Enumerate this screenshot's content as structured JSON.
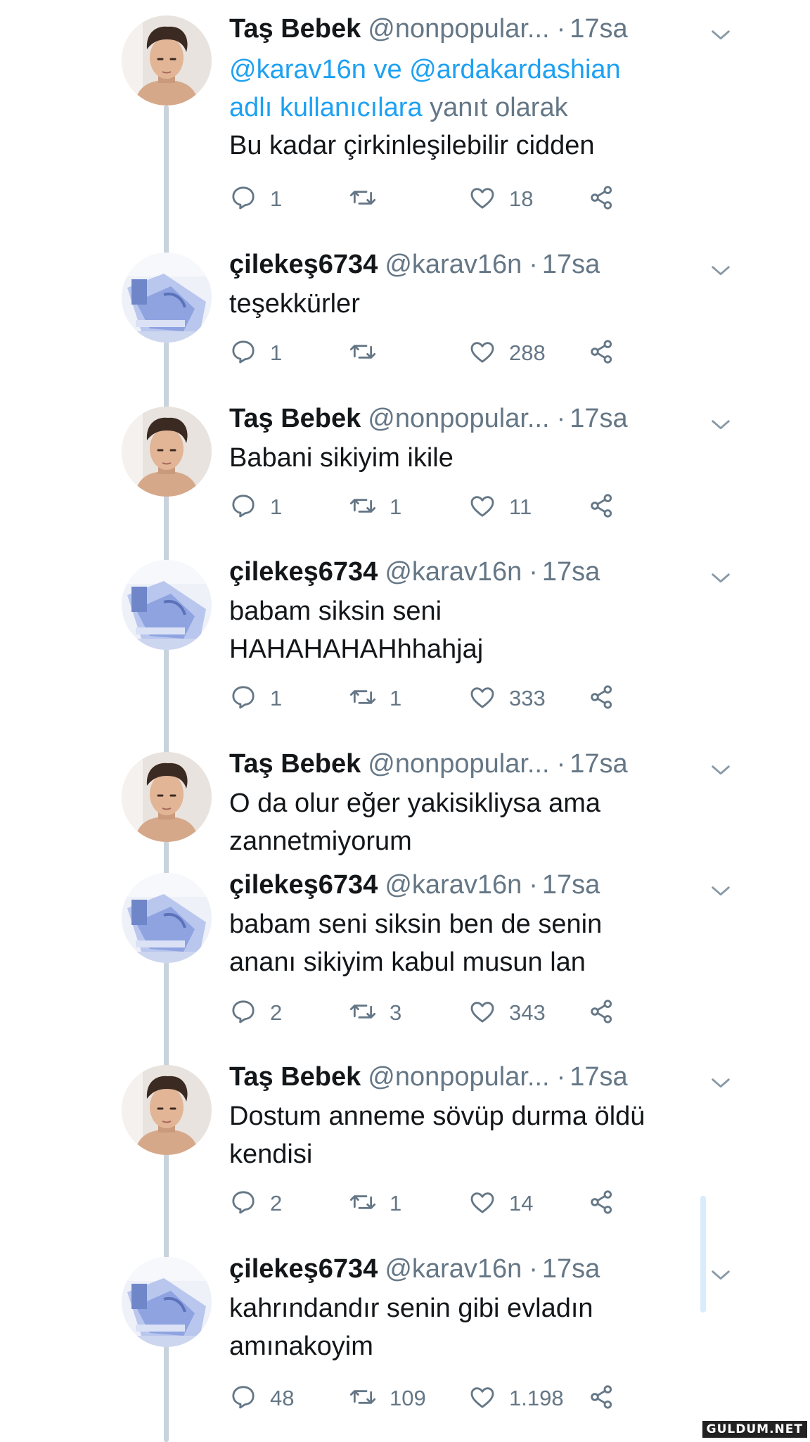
{
  "colors": {
    "link": "#1da1f2",
    "secondary": "#657786",
    "text": "#14171a",
    "thread_line": "#c8d3dc"
  },
  "users": {
    "tas": {
      "name": "Taş Bebek",
      "handle": "@nonpopular...",
      "avatar_icon": "person-photo-avatar"
    },
    "cilek": {
      "name": "çilekeş6734",
      "handle": "@karav16n",
      "avatar_icon": "hospital-photo-avatar"
    }
  },
  "reply_context": {
    "prefix": "",
    "mention1": "@karav16n",
    "connector": " ve ",
    "mention2": "@ardakardashian",
    "line2_link": "adlı kullanıcılara",
    "suffix": " yanıt olarak"
  },
  "tweets": [
    {
      "user": "tas",
      "name": "Taş Bebek",
      "handle": "@nonpopular...",
      "time": "17sa",
      "lines": [
        "Bu kadar çirkinleşilebilir cidden"
      ],
      "reply_count": "1",
      "retweet_count": "",
      "like_count": "18"
    },
    {
      "user": "cilek",
      "name": "çilekeş6734",
      "handle": "@karav16n",
      "time": "17sa",
      "lines": [
        "teşekkürler"
      ],
      "reply_count": "1",
      "retweet_count": "",
      "like_count": "288"
    },
    {
      "user": "tas",
      "name": "Taş Bebek",
      "handle": "@nonpopular...",
      "time": "17sa",
      "lines": [
        "Babani sikiyim ikile"
      ],
      "reply_count": "1",
      "retweet_count": "1",
      "like_count": "11"
    },
    {
      "user": "cilek",
      "name": "çilekeş6734",
      "handle": "@karav16n",
      "time": "17sa",
      "lines": [
        "babam siksin seni",
        "HAHAHAHAHhhahjaj"
      ],
      "reply_count": "1",
      "retweet_count": "1",
      "like_count": "333"
    },
    {
      "user": "tas",
      "name": "Taş Bebek",
      "handle": "@nonpopular...",
      "time": "17sa",
      "lines": [
        "O da olur eğer yakisikliysa ama",
        "zannetmiyorum"
      ],
      "reply_count": "",
      "retweet_count": "",
      "like_count": ""
    },
    {
      "user": "cilek",
      "name": "çilekeş6734",
      "handle": "@karav16n",
      "time": "17sa",
      "lines": [
        "babam seni siksin ben de senin",
        "ananı sikiyim kabul musun lan"
      ],
      "reply_count": "2",
      "retweet_count": "3",
      "like_count": "343"
    },
    {
      "user": "tas",
      "name": "Taş Bebek",
      "handle": "@nonpopular...",
      "time": "17sa",
      "lines": [
        "Dostum anneme sövüp durma öldü",
        "kendisi"
      ],
      "reply_count": "2",
      "retweet_count": "1",
      "like_count": "14"
    },
    {
      "user": "cilek",
      "name": "çilekeş6734",
      "handle": "@karav16n",
      "time": "17sa",
      "lines": [
        "kahrındandır senin gibi evladın",
        "amınakoyim"
      ],
      "reply_count": "48",
      "retweet_count": "109",
      "like_count": "1.198"
    }
  ],
  "icons": {
    "reply": "reply-icon",
    "retweet": "retweet-icon",
    "like": "heart-icon",
    "share": "share-icon",
    "menu": "chevron-down-icon"
  },
  "watermark": "GULDUM.NET"
}
